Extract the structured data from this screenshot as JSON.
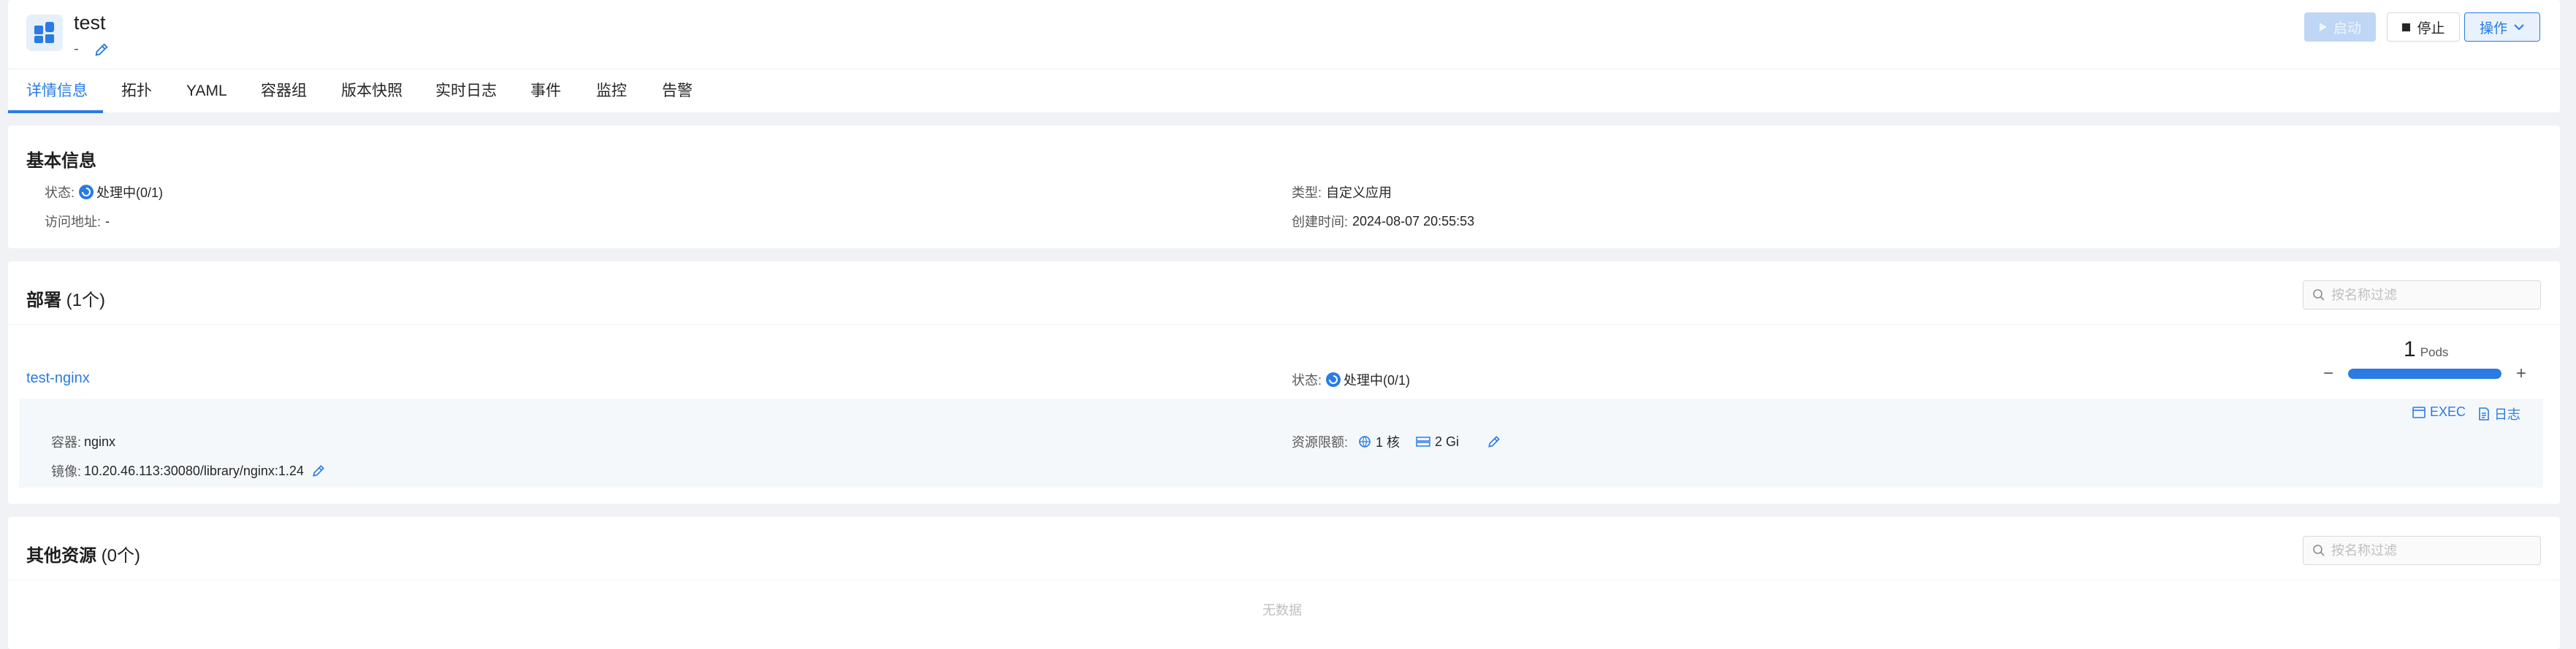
{
  "app": {
    "name": "test",
    "description": "-"
  },
  "header_actions": {
    "start": "启动",
    "stop": "停止",
    "operations": "操作"
  },
  "tabs": [
    "详情信息",
    "拓扑",
    "YAML",
    "容器组",
    "版本快照",
    "实时日志",
    "事件",
    "监控",
    "告警"
  ],
  "active_tab": "详情信息",
  "basic_info": {
    "title": "基本信息",
    "status_label": "状态:",
    "status_value": "处理中(0/1)",
    "access_label": "访问地址:",
    "access_value": "-",
    "type_label": "类型:",
    "type_value": "自定义应用",
    "created_label": "创建时间:",
    "created_value": "2024-08-07 20:55:53"
  },
  "deployments": {
    "title": "部署",
    "count": "(1个)",
    "search_placeholder": "按名称过滤",
    "item": {
      "name": "test-nginx",
      "status_label": "状态:",
      "status_value": "处理中(0/1)",
      "pods_count": "1",
      "pods_unit": "Pods",
      "pods_progress": 1.0,
      "minus": "−",
      "plus": "+",
      "exec_label": "EXEC",
      "logs_label": "日志",
      "container_label": "容器:",
      "container_value": "nginx",
      "image_label": "镜像:",
      "image_value": "10.20.46.113:30080/library/nginx:1.24",
      "limits_label": "资源限额:",
      "cpu_value": "1 核",
      "memory_value": "2 Gi"
    }
  },
  "other_resources": {
    "title": "其他资源",
    "count": "(0个)",
    "search_placeholder": "按名称过滤",
    "empty_text": "无数据"
  },
  "colors": {
    "accent": "#2a7be4",
    "page_bg": "#f0f2f5"
  }
}
